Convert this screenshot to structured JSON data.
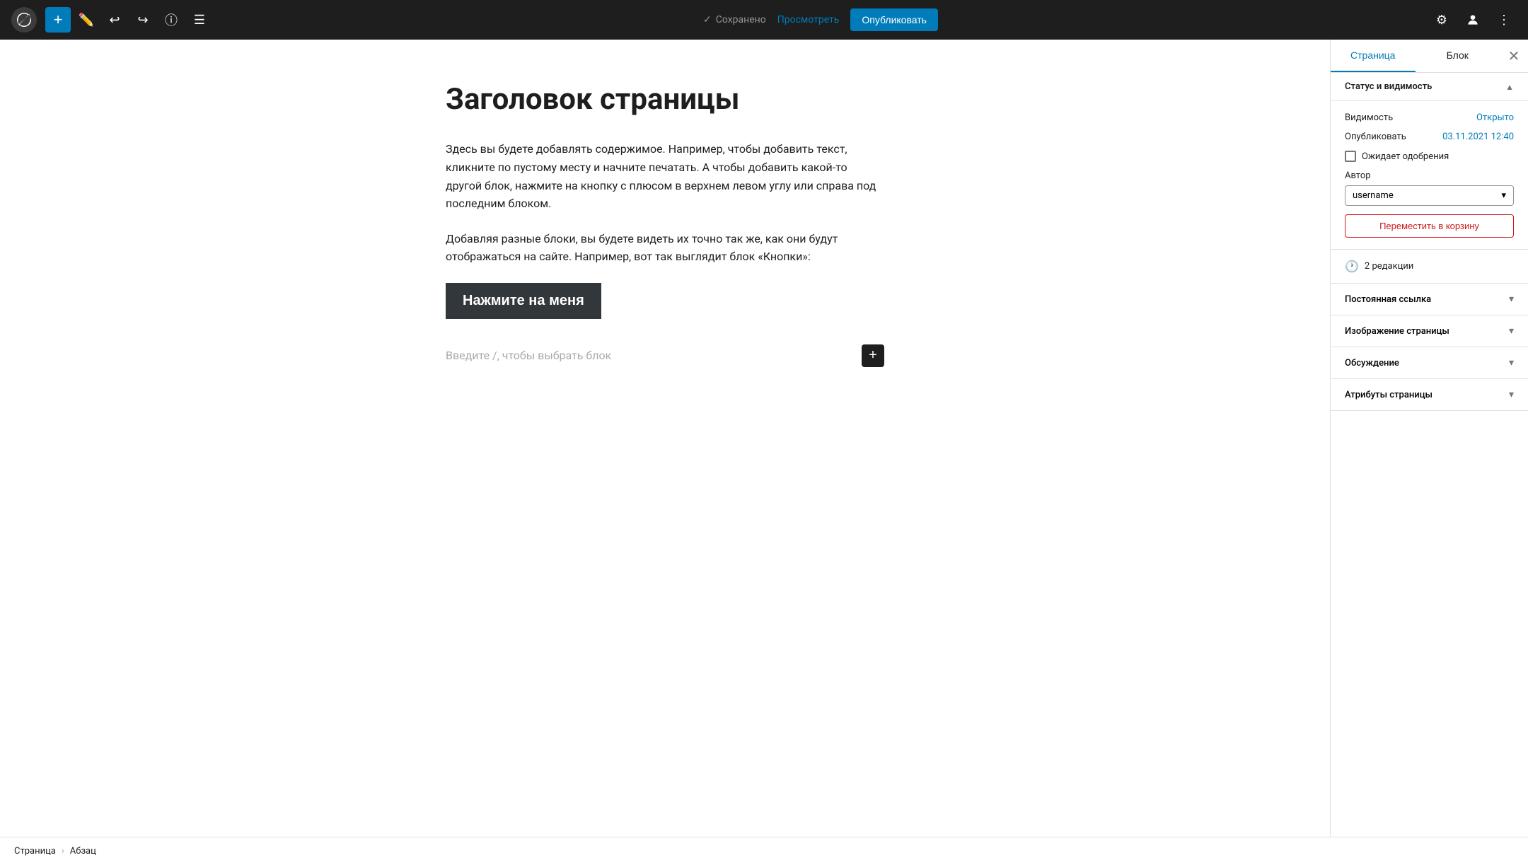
{
  "toolbar": {
    "add_label": "+",
    "saved_label": "Сохранено",
    "view_label": "Просмотреть",
    "publish_label": "Опубликовать"
  },
  "editor": {
    "page_title": "Заголовок страницы",
    "paragraph1": "Здесь вы будете добавлять содержимое. Например, чтобы добавить текст, кликните по пустому месту и начните печатать. А чтобы добавить какой-то другой блок, нажмите на кнопку с плюсом в верхнем левом углу или справа под последним блоком.",
    "paragraph2": "Добавляя разные блоки, вы будете видеть их точно так же, как они будут отображаться на сайте. Например, вот так выглядит блок «Кнопки»:",
    "button_label": "Нажмите на меня",
    "placeholder_text": "Введите /, чтобы выбрать блок"
  },
  "statusbar": {
    "item1": "Страница",
    "separator": "›",
    "item2": "Абзац"
  },
  "sidebar": {
    "tab_page": "Страница",
    "tab_block": "Блок",
    "section_status": "Статус и видимость",
    "label_visibility": "Видимость",
    "value_visibility": "Открыто",
    "label_publish": "Опубликовать",
    "value_publish": "03.11.2021 12:40",
    "label_pending": "Ожидает одобрения",
    "label_author": "Автор",
    "author_value": "username",
    "btn_trash": "Переместить в корзину",
    "revisions_count": "2 редакции",
    "section_permalink": "Постоянная ссылка",
    "section_image": "Изображение страницы",
    "section_discussion": "Обсуждение",
    "section_attributes": "Атрибуты страницы"
  }
}
